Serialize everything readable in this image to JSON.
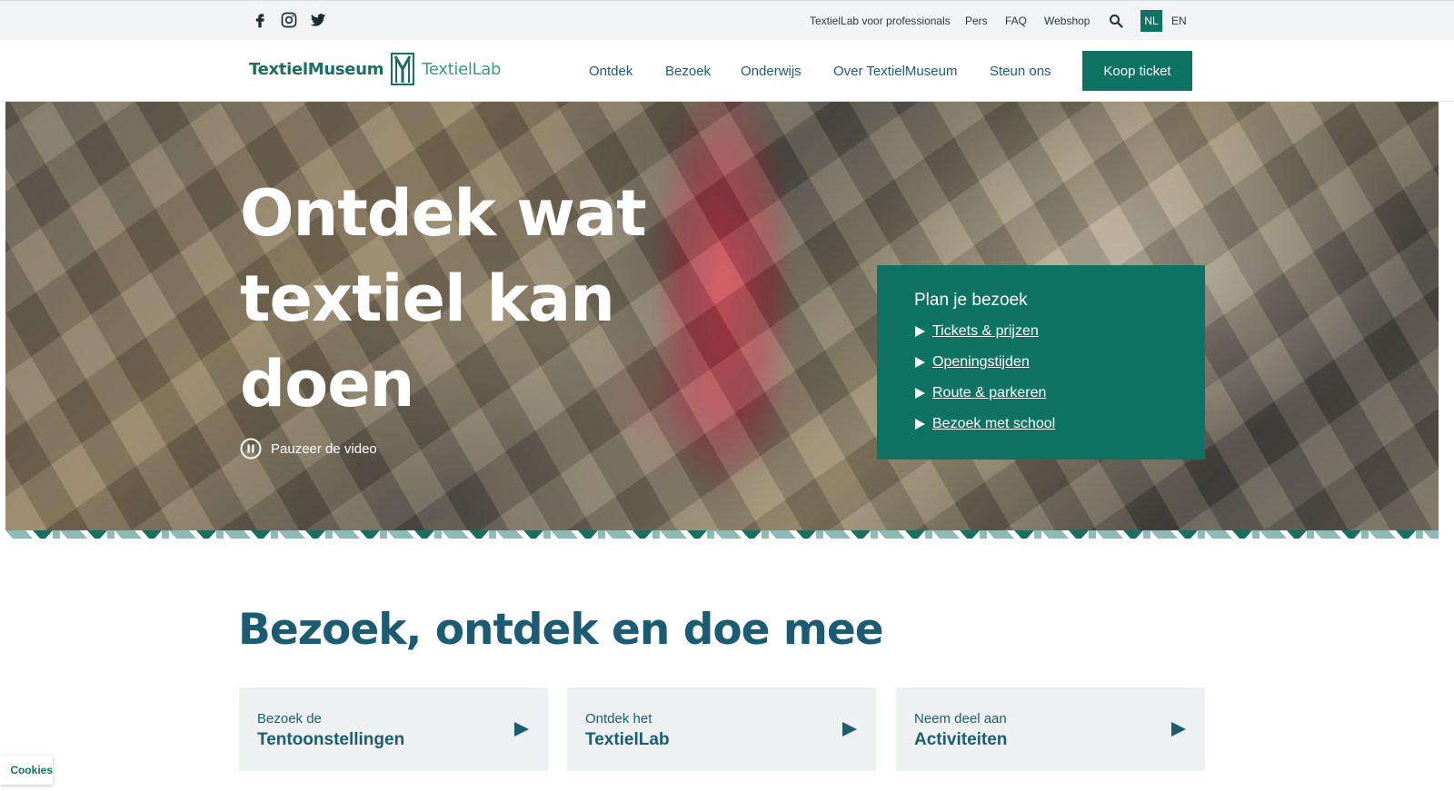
{
  "topbar": {
    "social": [
      "facebook-icon",
      "instagram-icon",
      "twitter-icon"
    ],
    "links": [
      "TextielLab voor professionals",
      "Pers",
      "FAQ",
      "Webshop"
    ],
    "languages": {
      "active": "NL",
      "other": "EN"
    }
  },
  "header": {
    "logo": {
      "part1": "TextielMuseum",
      "part2": "TextielLab"
    },
    "nav": [
      "Ontdek",
      "Bezoek",
      "Onderwijs",
      "Over TextielMuseum",
      "Steun ons"
    ],
    "cta": "Koop ticket"
  },
  "hero": {
    "title": "Ontdek wat textiel kan doen",
    "pause_label": "Pauzeer de video",
    "plan": {
      "title": "Plan je bezoek",
      "links": [
        "Tickets & prijzen",
        "Openingstijden",
        "Route & parkeren",
        "Bezoek met school"
      ]
    }
  },
  "section": {
    "title": "Bezoek, ontdek en doe mee",
    "cards": [
      {
        "sub": "Bezoek de",
        "main": "Tentoonstellingen"
      },
      {
        "sub": "Ontdek het",
        "main": "TextielLab"
      },
      {
        "sub": "Neem deel aan",
        "main": "Activiteiten"
      }
    ]
  },
  "cookies_label": "Cookies",
  "colors": {
    "brand_green": "#0f7363",
    "heading_blue": "#1b5b73",
    "zigzag": "#8fb9b5"
  }
}
